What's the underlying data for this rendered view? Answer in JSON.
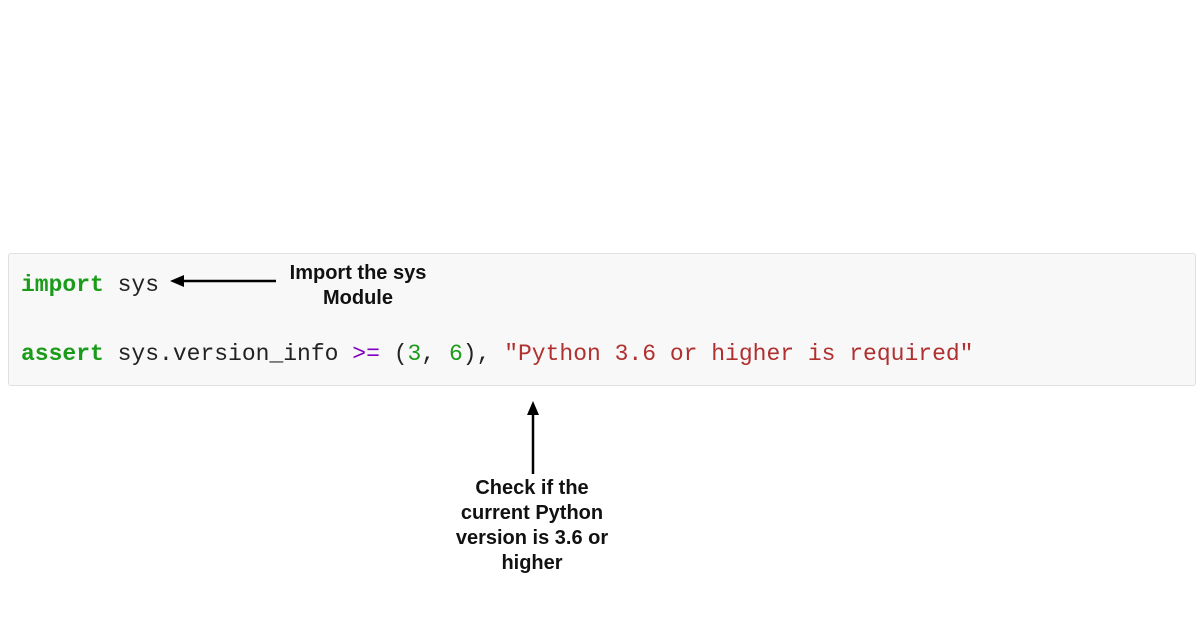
{
  "code": {
    "line1": {
      "import_kw": "import",
      "module": " sys"
    },
    "line2": {
      "assert_kw": "assert",
      "expr_prefix": " sys.version_info ",
      "operator": ">=",
      "space_after_op": " ",
      "paren_open": "(",
      "num1": "3",
      "comma1": ",",
      "space1": " ",
      "num2": "6",
      "paren_close": ")",
      "comma2": ",",
      "space2": " ",
      "message": "\"Python 3.6 or higher is required\""
    }
  },
  "annotations": {
    "import_label": "Import the sys\nModule",
    "assert_label": "Check if the\ncurrent Python\nversion is 3.6 or\nhigher"
  }
}
